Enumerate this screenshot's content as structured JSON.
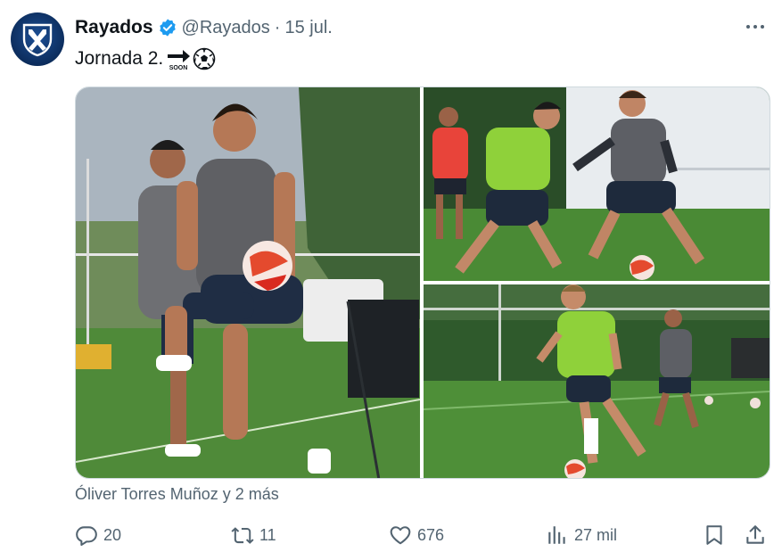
{
  "account": {
    "name": "Rayados",
    "handle": "@Rayados",
    "separator": "·",
    "date": "15 jul.",
    "avatar_icon": "rayados-crest-icon",
    "verified_icon": "verified-badge-icon",
    "brand_color": "#0c2d5d",
    "verified_color": "#1d9bf0"
  },
  "tweet": {
    "text": "Jornada 2.",
    "emojis": [
      "soon-arrow-emoji",
      "soccer-ball-emoji"
    ],
    "soon_label": "SOON"
  },
  "media": {
    "photos": [
      {
        "name": "photo-1",
        "alt_icon": "training-photo"
      },
      {
        "name": "photo-2",
        "alt_icon": "training-photo"
      },
      {
        "name": "photo-3",
        "alt_icon": "training-photo"
      }
    ],
    "tagged": "Óliver Torres Muñoz y 2 más",
    "tagged_icon": "person-icon"
  },
  "actions": {
    "replies": "20",
    "retweets": "11",
    "likes": "676",
    "views": "27 mil",
    "reply_icon": "reply-icon",
    "retweet_icon": "retweet-icon",
    "like_icon": "heart-icon",
    "views_icon": "views-chart-icon",
    "bookmark_icon": "bookmark-icon",
    "share_icon": "share-icon"
  },
  "menu": {
    "more_icon": "more-options-icon"
  }
}
